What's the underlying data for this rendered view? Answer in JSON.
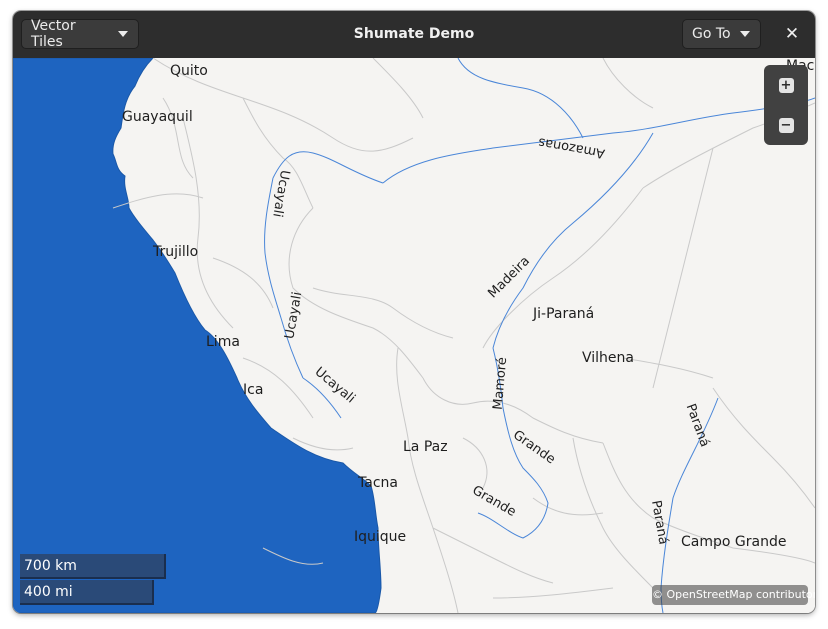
{
  "window": {
    "title": "Shumate Demo",
    "style_dropdown": {
      "label": "Vector Tiles"
    },
    "goto_dropdown": {
      "label": "Go To"
    },
    "close_symbol": "✕"
  },
  "map": {
    "colors": {
      "ocean": "#1e64c0",
      "land": "#f5f4f2",
      "border": "#c8c8c8",
      "river": "#4a86d8"
    },
    "cities": {
      "quito": "Quito",
      "guayaquil": "Guayaquil",
      "trujillo": "Trujillo",
      "lima": "Lima",
      "ica": "Ica",
      "la_paz": "La Paz",
      "tacna": "Tacna",
      "iquique": "Iquique",
      "ji_parana": "Ji-Paraná",
      "vilhena": "Vilhena",
      "campo_grande": "Campo Grande",
      "mac_cut": "Mac"
    },
    "rivers": {
      "amazonas": "Amazonas",
      "ucayali_1": "Ucayali",
      "ucayali_2": "Ucayali",
      "ucayali_3": "Ucayali",
      "madeira": "Madeira",
      "mamore": "Mamoré",
      "grande_1": "Grande",
      "grande_2": "Grande",
      "parana_1": "Paraná",
      "parana_2": "Paraná"
    },
    "zoom": {
      "in_symbol": "+",
      "out_symbol": "−"
    },
    "scale": {
      "metric": "700 km",
      "imperial": "400 mi"
    },
    "attribution": "© OpenStreetMap contributors"
  }
}
